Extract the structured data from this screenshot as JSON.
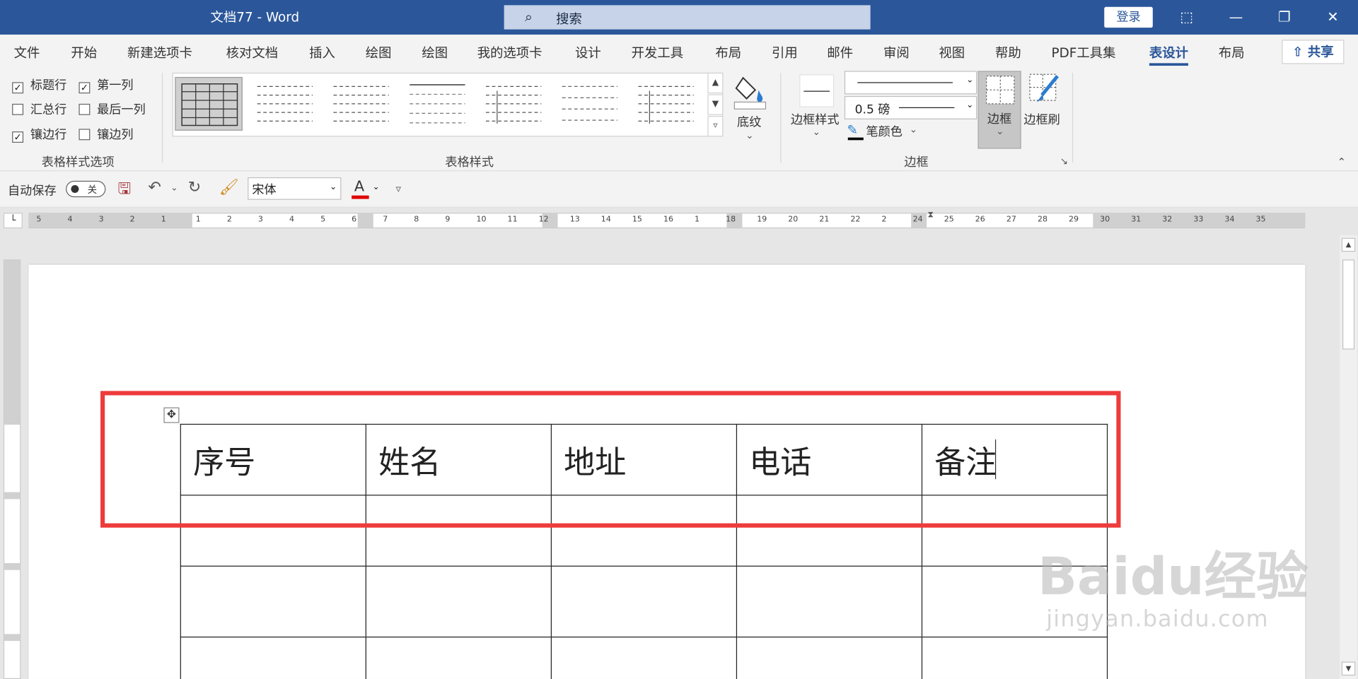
{
  "titlebar": {
    "doc_title": "文档77  -  Word",
    "search_placeholder": "搜索",
    "login_label": "登录",
    "window_buttons": [
      "ribbon-display-icon",
      "minimize-icon",
      "restore-icon",
      "close-icon"
    ]
  },
  "menu": {
    "tabs": [
      "文件",
      "开始",
      "新建选项卡",
      "核对文档",
      "插入",
      "绘图",
      "绘图",
      "我的选项卡",
      "设计",
      "开发工具",
      "布局",
      "引用",
      "邮件",
      "审阅",
      "视图",
      "帮助",
      "PDF工具集",
      "表设计",
      "布局"
    ],
    "active_tab": "表设计",
    "share_label": "共享"
  },
  "ribbon": {
    "style_options": {
      "header_row": {
        "label": "标题行",
        "checked": true
      },
      "first_column": {
        "label": "第一列",
        "checked": true
      },
      "total_row": {
        "label": "汇总行",
        "checked": false
      },
      "last_column": {
        "label": "最后一列",
        "checked": false
      },
      "banded_rows": {
        "label": "镶边行",
        "checked": true
      },
      "banded_columns": {
        "label": "镶边列",
        "checked": false
      },
      "group_label": "表格样式选项"
    },
    "table_styles": {
      "group_label": "表格样式",
      "shading_label": "底纹"
    },
    "borders": {
      "group_label": "边框",
      "border_styles_label": "边框样式",
      "line_weight": "0.5 磅",
      "pen_color_label": "笔颜色",
      "borders_label": "边框",
      "border_painter_label": "边框刷"
    }
  },
  "quick_access": {
    "autosave_label": "自动保存",
    "autosave_state": "关",
    "font_name": "宋体",
    "font_color_glyph": "A"
  },
  "ruler": {
    "h_numbers": [
      "5",
      "4",
      "3",
      "2",
      "1",
      "1",
      "2",
      "3",
      "4",
      "5",
      "6",
      "7",
      "8",
      "9",
      "10",
      "11",
      "12",
      "13",
      "14",
      "15",
      "16",
      "1",
      "18",
      "19",
      "20",
      "21",
      "22",
      "2",
      "24",
      "25",
      "26",
      "27",
      "28",
      "29",
      "30",
      "31",
      "32",
      "33",
      "34",
      "35"
    ]
  },
  "document": {
    "table": {
      "headers": [
        "序号",
        "姓名",
        "地址",
        "电话",
        "备注"
      ],
      "empty_rows": 3
    }
  },
  "watermark": {
    "brand": "Baidu经验",
    "url": "jingyan.baidu.com"
  },
  "colors": {
    "accent": "#2b579a",
    "highlight": "#ee3b3b",
    "font_color": "#e00000"
  }
}
